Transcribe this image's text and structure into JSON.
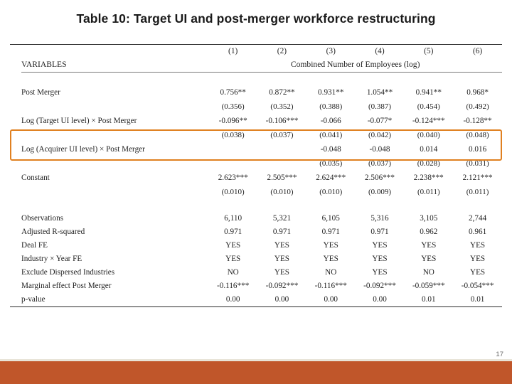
{
  "slide": {
    "title": "Table 10: Target UI and post-merger workforce restructuring",
    "page_number": "17",
    "accent_color": "#c0562a",
    "highlight_color": "#e08020"
  },
  "table": {
    "column_numbers": [
      "(1)",
      "(2)",
      "(3)",
      "(4)",
      "(5)",
      "(6)"
    ],
    "variables_header": "VARIABLES",
    "span_header": "Combined Number of Employees (log)",
    "rows": [
      {
        "label": "Post Merger",
        "coefficients": [
          "0.756**",
          "0.872**",
          "0.931**",
          "1.054**",
          "0.941**",
          "0.968*"
        ],
        "std_errors": [
          "(0.356)",
          "(0.352)",
          "(0.388)",
          "(0.387)",
          "(0.454)",
          "(0.492)"
        ]
      },
      {
        "label": "Log (Target UI level) × Post Merger",
        "coefficients": [
          "-0.096**",
          "-0.106***",
          "-0.066",
          "-0.077*",
          "-0.124***",
          "-0.128**"
        ],
        "std_errors": [
          "(0.038)",
          "(0.037)",
          "(0.041)",
          "(0.042)",
          "(0.040)",
          "(0.048)"
        ],
        "highlighted": true
      },
      {
        "label": "Log (Acquirer UI level) × Post Merger",
        "coefficients": [
          "",
          "",
          "-0.048",
          "-0.048",
          "0.014",
          "0.016"
        ],
        "std_errors": [
          "",
          "",
          "(0.035)",
          "(0.037)",
          "(0.028)",
          "(0.031)"
        ]
      },
      {
        "label": "Constant",
        "coefficients": [
          "2.623***",
          "2.505***",
          "2.624***",
          "2.506***",
          "2.238***",
          "2.121***"
        ],
        "std_errors": [
          "(0.010)",
          "(0.010)",
          "(0.010)",
          "(0.009)",
          "(0.011)",
          "(0.011)"
        ]
      }
    ],
    "stats_rows": [
      {
        "label": "Observations",
        "values": [
          "6,110",
          "5,321",
          "6,105",
          "5,316",
          "3,105",
          "2,744"
        ]
      },
      {
        "label": "Adjusted R-squared",
        "values": [
          "0.971",
          "0.971",
          "0.971",
          "0.971",
          "0.962",
          "0.961"
        ]
      },
      {
        "label": "Deal FE",
        "values": [
          "YES",
          "YES",
          "YES",
          "YES",
          "YES",
          "YES"
        ]
      },
      {
        "label": "Industry × Year FE",
        "values": [
          "YES",
          "YES",
          "YES",
          "YES",
          "YES",
          "YES"
        ]
      },
      {
        "label": "Exclude Dispersed Industries",
        "values": [
          "NO",
          "YES",
          "NO",
          "YES",
          "NO",
          "YES"
        ]
      },
      {
        "label": "Marginal effect Post Merger",
        "values": [
          "-0.116***",
          "-0.092***",
          "-0.116***",
          "-0.092***",
          "-0.059***",
          "-0.054***"
        ]
      },
      {
        "label": "p-value",
        "values": [
          "0.00",
          "0.00",
          "0.00",
          "0.00",
          "0.01",
          "0.01"
        ]
      }
    ]
  }
}
